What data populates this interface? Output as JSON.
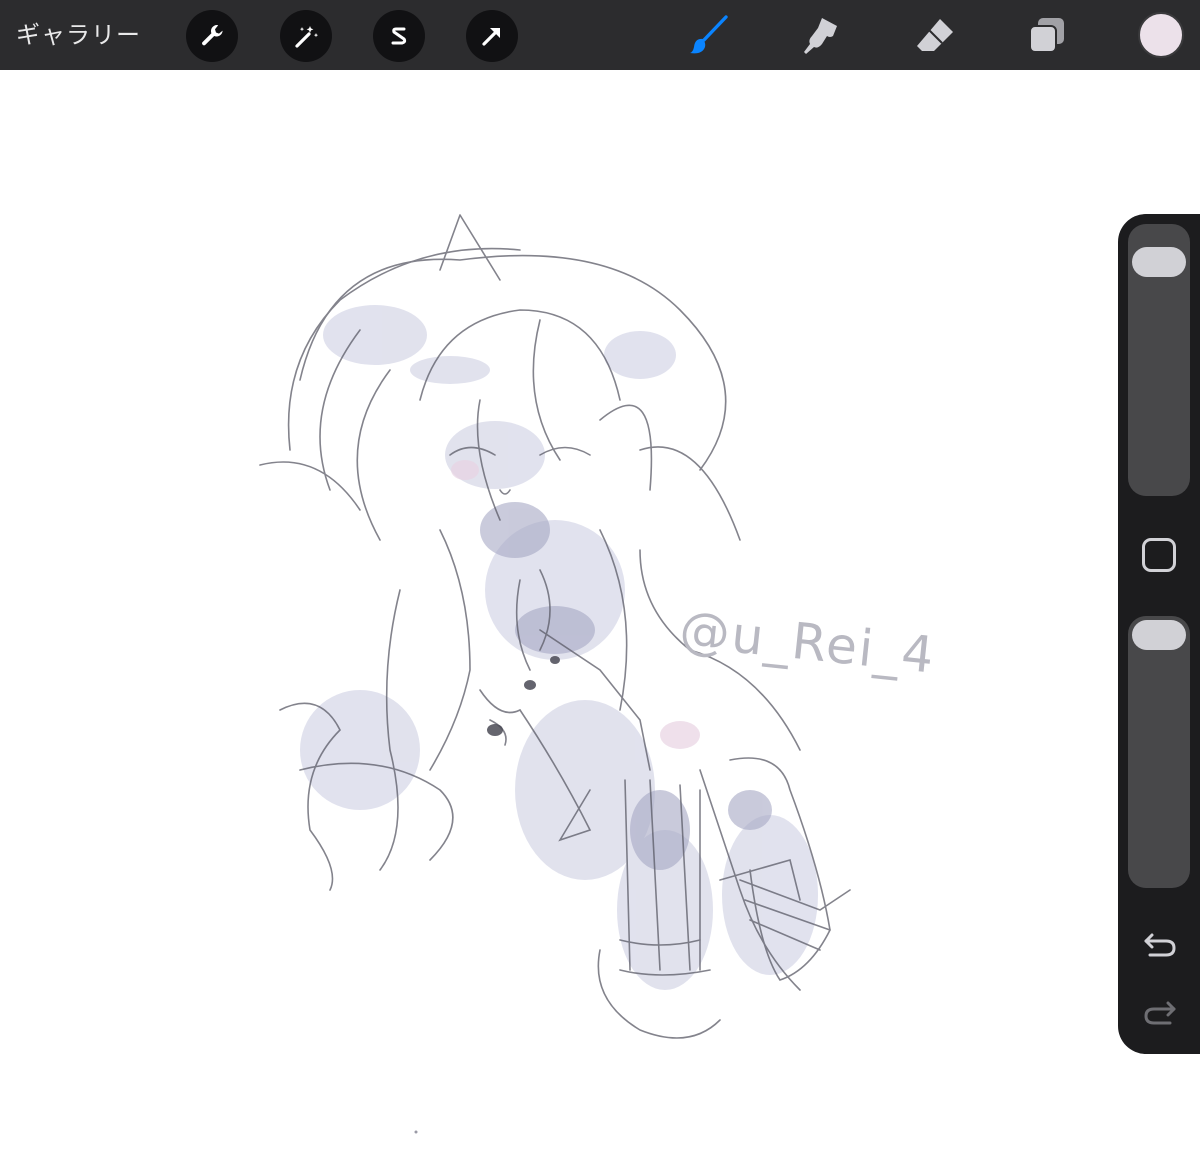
{
  "topbar": {
    "gallery_label": "ギャラリー",
    "left_tools": [
      "wrench-icon",
      "magic-wand-icon",
      "selection-s-icon",
      "transform-arrow-icon"
    ],
    "right_tools": [
      "brush-icon",
      "smudge-icon",
      "eraser-icon",
      "layers-icon"
    ],
    "active_tool": "brush-icon",
    "current_color": "#ece1ea",
    "accent_color": "#0a84ff"
  },
  "canvas": {
    "watermark": "@u_Rei_4"
  },
  "sidebar": {
    "brush_size_level": 0.08,
    "opacity_level": 0.0,
    "undo_icon": "undo-icon",
    "redo_icon": "redo-icon"
  }
}
